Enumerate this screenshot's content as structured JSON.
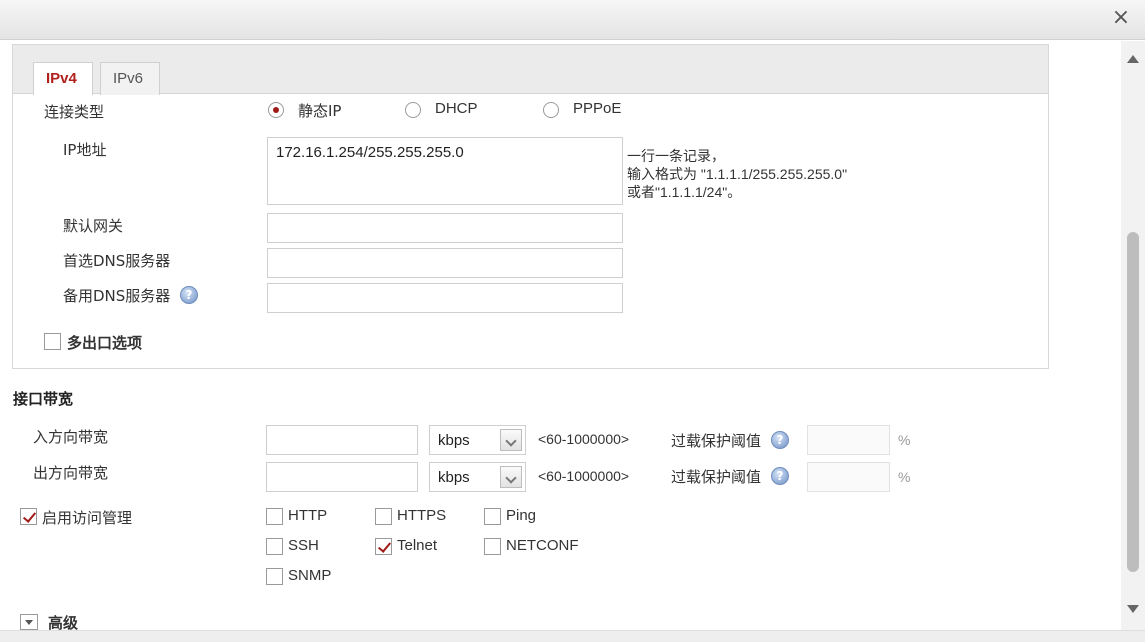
{
  "window": {
    "close_glyph": "×"
  },
  "tabs": [
    {
      "label": "IPv4",
      "active": true
    },
    {
      "label": "IPv6",
      "active": false
    }
  ],
  "connection": {
    "label": "连接类型",
    "options": [
      {
        "label": "静态IP",
        "selected": true
      },
      {
        "label": "DHCP",
        "selected": false
      },
      {
        "label": "PPPoE",
        "selected": false
      }
    ]
  },
  "ip": {
    "label": "IP地址",
    "value": "172.16.1.254/255.255.255.0",
    "hint_line1": "一行一条记录，",
    "hint_line2": "输入格式为 \"1.1.1.1/255.255.255.0\"",
    "hint_line3": "或者\"1.1.1.1/24\"。"
  },
  "gateway": {
    "label": "默认网关",
    "value": ""
  },
  "dns_primary": {
    "label": "首选DNS服务器",
    "value": ""
  },
  "dns_backup": {
    "label": "备用DNS服务器",
    "value": "",
    "help": "?"
  },
  "multi_exit": {
    "label": "多出口选项",
    "checked": false
  },
  "bandwidth": {
    "title": "接口带宽",
    "rows": [
      {
        "label": "入方向带宽",
        "value": "",
        "unit": "kbps",
        "range": "<60-1000000>",
        "overload_label": "过载保护阈值",
        "help": "?",
        "percent_value": "",
        "percent_unit": "%"
      },
      {
        "label": "出方向带宽",
        "value": "",
        "unit": "kbps",
        "range": "<60-1000000>",
        "overload_label": "过载保护阈值",
        "help": "?",
        "percent_value": "",
        "percent_unit": "%"
      }
    ]
  },
  "access": {
    "label": "启用访问管理",
    "enabled": true,
    "protocols": [
      {
        "label": "HTTP",
        "checked": false
      },
      {
        "label": "HTTPS",
        "checked": false
      },
      {
        "label": "Ping",
        "checked": false
      },
      {
        "label": "SSH",
        "checked": false
      },
      {
        "label": "Telnet",
        "checked": true
      },
      {
        "label": "NETCONF",
        "checked": false
      },
      {
        "label": "SNMP",
        "checked": false
      }
    ]
  },
  "advanced": {
    "label": "高级"
  },
  "colors": {
    "accent": "#a01b17",
    "tab_active_text": "#b0201c"
  }
}
